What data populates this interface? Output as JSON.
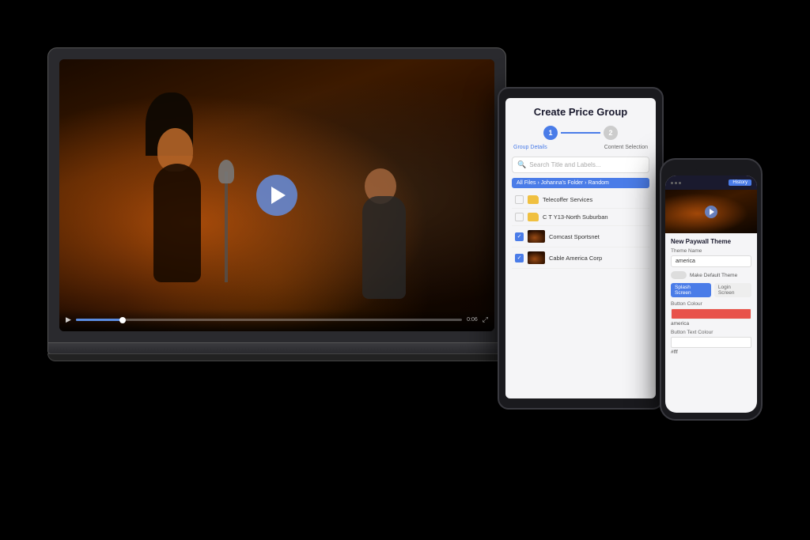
{
  "background": "#000000",
  "laptop": {
    "video": {
      "alt": "Concert performance - singer with microphone and guitarist",
      "play_button_label": "▶",
      "time": "0:06",
      "progress_percent": 12
    }
  },
  "tablet": {
    "title": "Create Price Group",
    "stepper": {
      "step1_label": "Group Details",
      "step2_label": "Content Selection"
    },
    "search_placeholder": "Search Title and Labels...",
    "breadcrumb": "All Files › Johanna's Folder › Random",
    "files": [
      {
        "name": "Telecoffer Services",
        "type": "folder",
        "checked": false
      },
      {
        "name": "C T Y13-North Suburban",
        "type": "folder",
        "checked": false
      },
      {
        "name": "Comcast Sportsnet",
        "type": "video",
        "checked": true
      },
      {
        "name": "Cable America Corp",
        "type": "video",
        "checked": true
      }
    ]
  },
  "phone": {
    "header": {
      "dots": [
        "•",
        "•",
        "•"
      ],
      "button_label": "History"
    },
    "section_title": "New Paywall Theme",
    "theme_name_label": "Theme Name",
    "theme_name_placeholder": "america",
    "make_default_label": "Make Default Theme",
    "splash_screen_label": "Splash Screen",
    "login_screen_label": "Login Screen",
    "button_colour_label": "Button Colour",
    "button_colour_value": "america",
    "button_text_colour_label": "Button Text Colour",
    "button_text_colour_value": "#fff"
  },
  "icons": {
    "play": "▶",
    "search": "🔍",
    "folder": "📁",
    "check": "✓"
  }
}
